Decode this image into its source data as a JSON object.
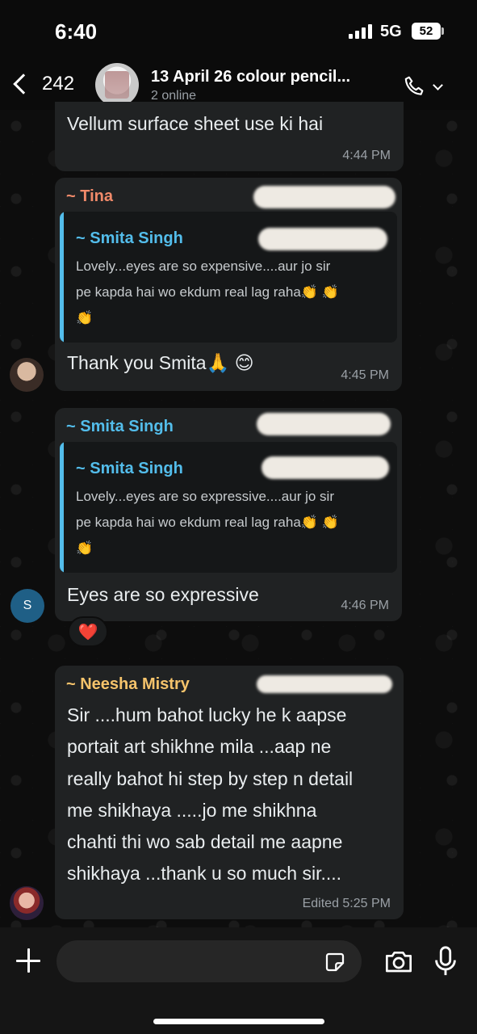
{
  "status_bar": {
    "time": "6:40",
    "network": "5G",
    "battery": "52"
  },
  "header": {
    "back_count": "242",
    "title": "13 April 26 colour pencil...",
    "subtitle": "2 online"
  },
  "messages": [
    {
      "text": "Vellum surface sheet use ki hai",
      "time": "4:44 PM"
    },
    {
      "sender": "~ Tina",
      "quote_sender": "~ Smita Singh",
      "quote_lines": [
        "Lovely...eyes are so expensive....aur jo sir",
        "pe kapda hai wo ekdum real lag raha👏 👏",
        "👏"
      ],
      "text": "Thank you Smita🙏 😊",
      "time": "4:45 PM"
    },
    {
      "sender": "~ Smita Singh",
      "quote_sender": "~ Smita Singh",
      "quote_lines": [
        "Lovely...eyes are so expressive....aur jo sir",
        "pe kapda hai wo ekdum real lag raha👏 👏",
        "👏"
      ],
      "text": "Eyes are so expressive",
      "time": "4:46 PM",
      "reaction": "❤️",
      "avatar_initial": "S"
    },
    {
      "sender": "~ Neesha Mistry",
      "lines": [
        "Sir ....hum  bahot lucky he k aapse",
        "portait art shikhne mila ...aap ne",
        "really bahot hi step by step n detail",
        "me shikhaya .....jo me shikhna",
        "chahti thi wo sab detail me aapne",
        "shikhaya ...thank u so much sir...."
      ],
      "time": "Edited 5:25 PM"
    }
  ],
  "composer": {
    "placeholder": ""
  },
  "colors": {
    "tina": "#f08a6a",
    "smita": "#53bdeb",
    "neesha": "#f5c36b",
    "bubble": "#202223"
  }
}
